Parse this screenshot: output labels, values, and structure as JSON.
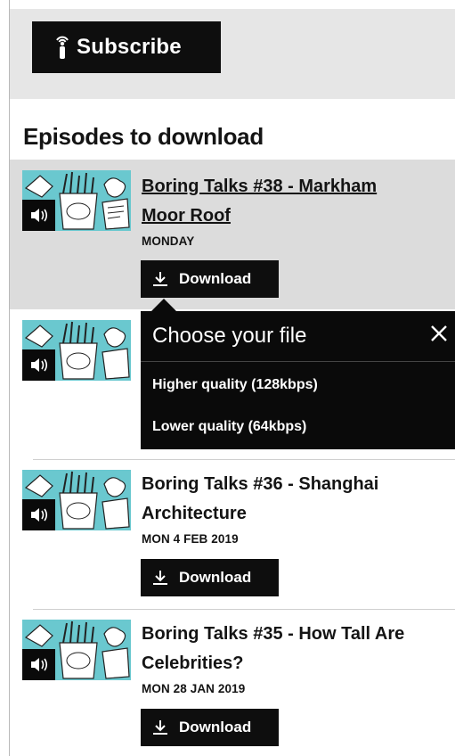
{
  "subscribe": {
    "label": "Subscribe",
    "icon": "podcast-icon"
  },
  "section": {
    "title": "Episodes to download"
  },
  "episodes": [
    {
      "title_line1": "Boring Talks #38 - Markham",
      "title_line2": "Moor Roof",
      "date": "MONDAY",
      "download_label": "Download",
      "active": true
    },
    {
      "title_line1": "",
      "title_line2": "",
      "date": "",
      "download_label": ""
    },
    {
      "title_line1": "Boring Talks #36 - Shanghai",
      "title_line2": "Architecture",
      "date": "MON 4 FEB 2019",
      "download_label": "Download"
    },
    {
      "title_line1": "Boring Talks #35 - How Tall Are",
      "title_line2": "Celebrities?",
      "date": "MON 28 JAN 2019",
      "download_label": "Download"
    }
  ],
  "popup": {
    "title": "Choose your file",
    "options": [
      "Higher quality (128kbps)",
      "Lower quality (64kbps)"
    ]
  },
  "colors": {
    "dark": "#0e0e0e",
    "band": "#e6e6e6",
    "active_row": "#dcdcdc",
    "thumb_bg": "#6ac8cf"
  }
}
